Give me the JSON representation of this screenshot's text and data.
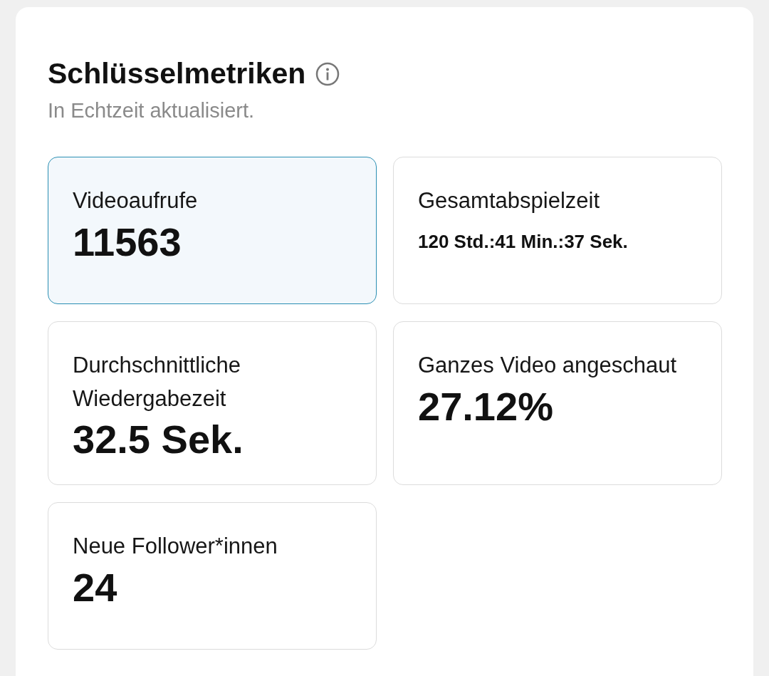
{
  "header": {
    "title": "Schlüsselmetriken",
    "subtitle": "In Echtzeit aktualisiert."
  },
  "metrics": [
    {
      "label": "Videoaufrufe",
      "value": "11563",
      "kind": "large",
      "selected": true
    },
    {
      "label": "Gesamtabspielzeit",
      "value": "120 Std.:41 Min.:37 Sek.",
      "kind": "compact",
      "selected": false
    },
    {
      "label": "Durchschnittliche Wiedergabezeit",
      "value": "32.5 Sek.",
      "kind": "large",
      "selected": false
    },
    {
      "label": "Ganzes Video angeschaut",
      "value": "27.12%",
      "kind": "large",
      "selected": false
    },
    {
      "label": "Neue Follower*innen",
      "value": "24",
      "kind": "large",
      "selected": false
    }
  ]
}
